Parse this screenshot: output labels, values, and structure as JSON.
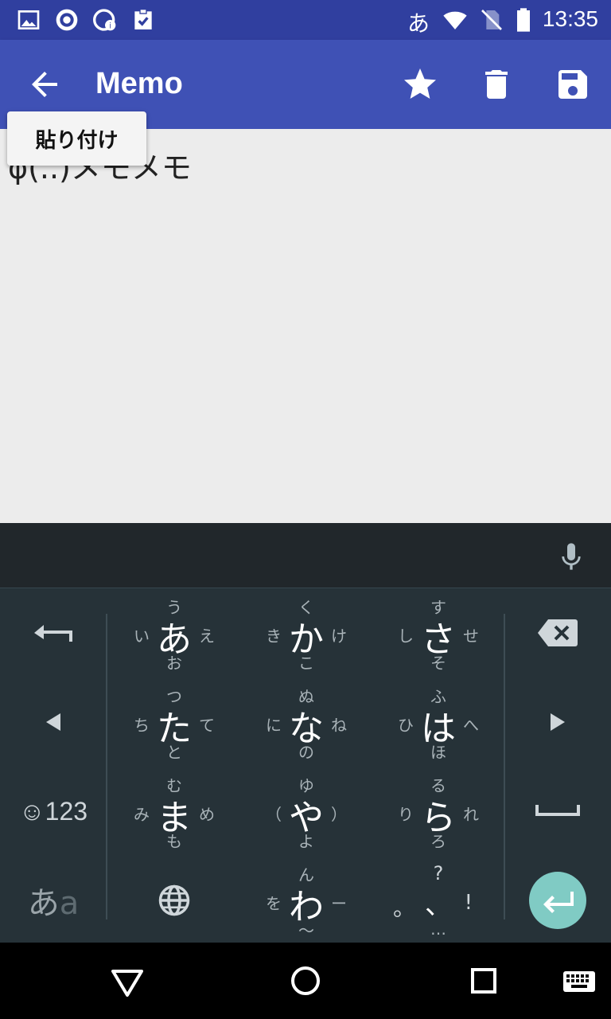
{
  "status_bar": {
    "time": "13:35",
    "ime_indicator": "あ",
    "icons": [
      "image-icon",
      "app-a-icon",
      "timer-info-icon",
      "clipboard-check-icon",
      "wifi-icon",
      "no-sim-icon",
      "battery-icon"
    ]
  },
  "app_bar": {
    "title": "Memo",
    "background": "#3f51b5",
    "status_color": "#303f9f",
    "actions": [
      "back-arrow-icon",
      "star-icon",
      "trash-icon",
      "save-icon"
    ]
  },
  "popup": {
    "paste_label": "貼り付け"
  },
  "memo": {
    "text": "φ(..)メモメモ"
  },
  "keyboard": {
    "accent": "#80cbc4",
    "rows": [
      [
        {
          "main": "あ",
          "up": "う",
          "down": "お",
          "left": "い",
          "right": "え"
        },
        {
          "main": "か",
          "up": "く",
          "down": "こ",
          "left": "き",
          "right": "け"
        },
        {
          "main": "さ",
          "up": "す",
          "down": "そ",
          "left": "し",
          "right": "せ"
        }
      ],
      [
        {
          "main": "た",
          "up": "つ",
          "down": "と",
          "left": "ち",
          "right": "て"
        },
        {
          "main": "な",
          "up": "ぬ",
          "down": "の",
          "left": "に",
          "right": "ね"
        },
        {
          "main": "は",
          "up": "ふ",
          "down": "ほ",
          "left": "ひ",
          "right": "へ"
        }
      ],
      [
        {
          "main": "ま",
          "up": "む",
          "down": "も",
          "left": "み",
          "right": "め"
        },
        {
          "main": "や",
          "up": "ゆ",
          "down": "よ",
          "left": "（",
          "right": "）"
        },
        {
          "main": "ら",
          "up": "る",
          "down": "ろ",
          "left": "り",
          "right": "れ"
        }
      ],
      [
        {
          "main": "わ",
          "up": "ん",
          "down": "～",
          "left": "を",
          "right": "ー"
        }
      ]
    ],
    "punct_key": {
      "up": "?",
      "down": "…",
      "left": "。",
      "main": "、",
      "right": "!"
    },
    "symbols_label": "☺123",
    "kana_label_main": "あ",
    "kana_label_small": "a"
  }
}
